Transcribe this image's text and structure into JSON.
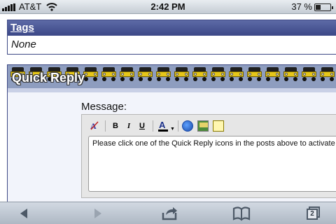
{
  "status_bar": {
    "carrier": "AT&T",
    "time": "2:42 PM",
    "battery": "37 %",
    "battery_level": 0.37
  },
  "tags": {
    "heading": "Tags",
    "value": "None"
  },
  "quick_reply": {
    "title": "Quick Reply",
    "message_label": "Message:",
    "textarea_text": "Please click one of the Quick Reply icons in the posts above to activate Quick Reply.",
    "toolbar": {
      "bold": "B",
      "italic": "I",
      "underline": "U",
      "font_color_glyph": "A"
    }
  },
  "bottom_bar": {
    "tab_count": "2"
  },
  "colors": {
    "header_blue": "#3b4787",
    "jeep_yellow": "#e6c619"
  }
}
